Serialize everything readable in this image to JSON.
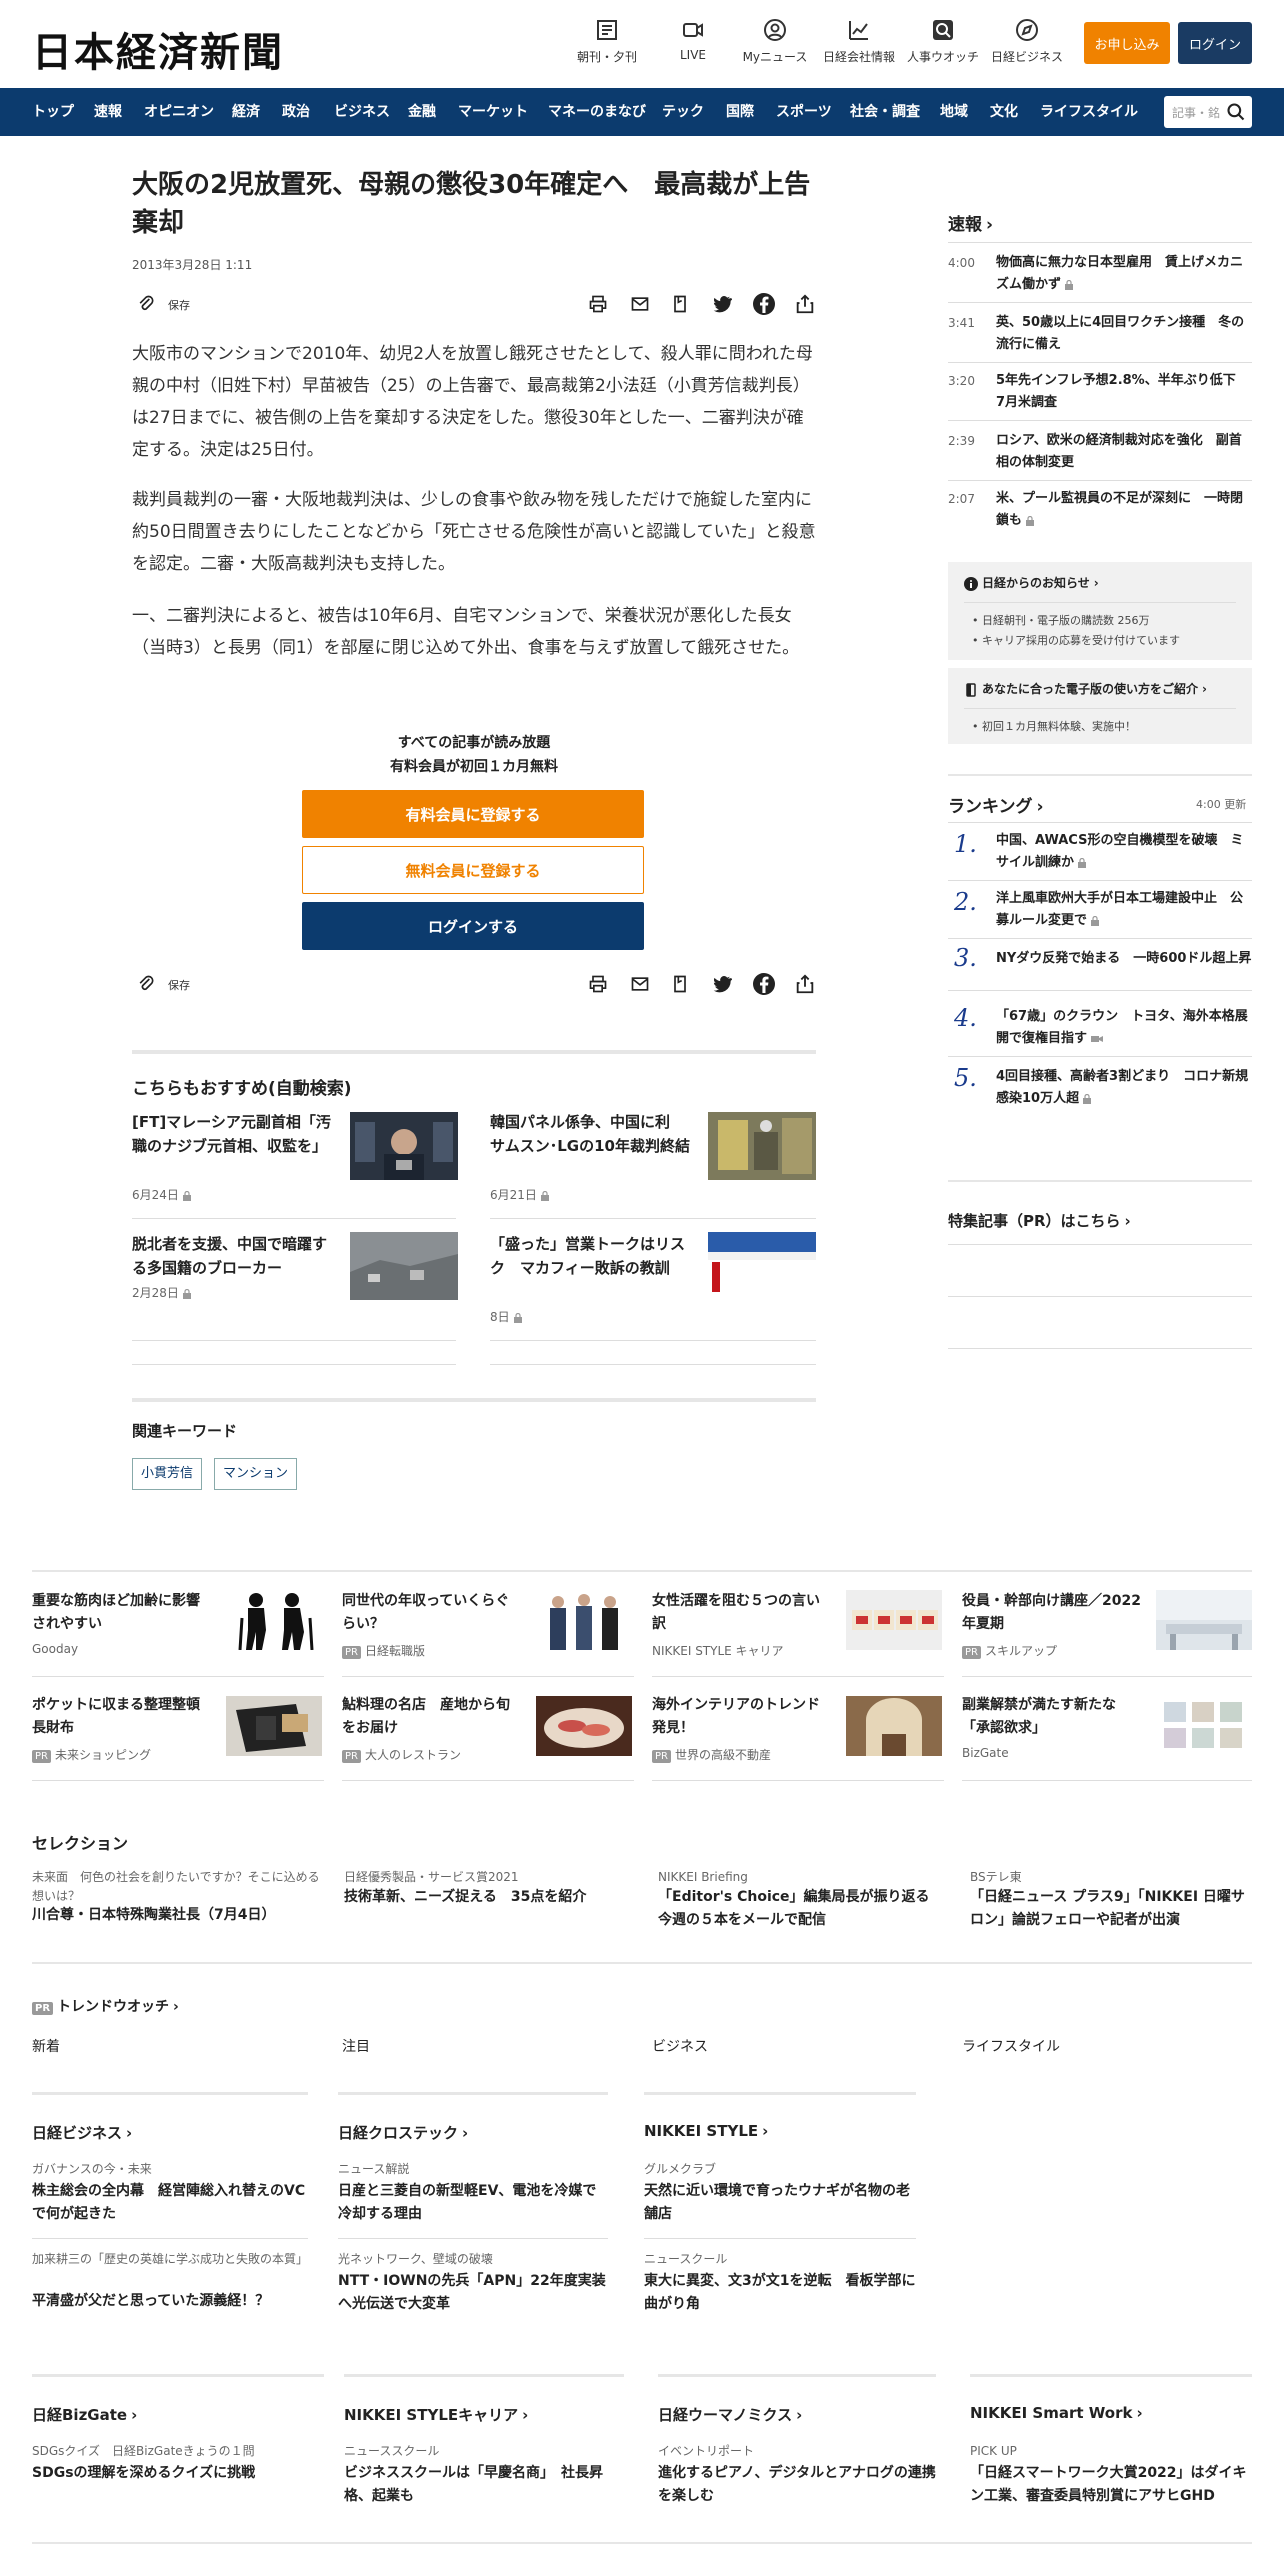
{
  "header": {
    "logo": "日本経済新聞",
    "tools": [
      {
        "label": "朝刊・夕刊",
        "icon": "newspaper-icon"
      },
      {
        "label": "LIVE",
        "icon": "video-icon"
      },
      {
        "label": "Myニュース",
        "icon": "person-icon"
      },
      {
        "label": "日経会社情報",
        "icon": "chart-icon"
      },
      {
        "label": "人事ウオッチ",
        "icon": "magnifier-icon"
      },
      {
        "label": "日経ビジネス",
        "icon": "compass-icon"
      }
    ],
    "subscribe": "お申し込み",
    "login": "ログイン"
  },
  "nav": {
    "items": [
      "トップ",
      "速報",
      "オピニオン",
      "経済",
      "政治",
      "ビジネス",
      "金融",
      "マーケット",
      "マネーのまなび",
      "テック",
      "国際",
      "スポーツ",
      "社会・調査",
      "地域",
      "文化",
      "ライフスタイル"
    ],
    "search_placeholder": "記事・銘柄"
  },
  "article": {
    "title": "大阪の2児放置死、母親の懲役30年確定へ　最高裁が上告棄却",
    "date": "2013年3月28日 1:11",
    "save": "保存",
    "paragraphs": [
      "大阪市のマンションで2010年、幼児2人を放置し餓死させたとして、殺人罪に問われた母親の中村（旧姓下村）早苗被告（25）の上告審で、最高裁第2小法廷（小貫芳信裁判長）は27日までに、被告側の上告を棄却する決定をした。懲役30年とした一、二審判決が確定する。決定は25日付。",
      "裁判員裁判の一審・大阪地裁判決は、少しの食事や飲み物を残しただけで施錠した室内に約50日間置き去りにしたことなどから「死亡させる危険性が高いと認識していた」と殺意を認定。二審・大阪高裁判決も支持した。",
      "一、二審判決によると、被告は10年6月、自宅マンションで、栄養状況が悪化した長女（当時3）と長男（同1）を部屋に閉じ込めて外出、食事を与えず放置して餓死させた。"
    ],
    "cta_line1": "すべての記事が読み放題",
    "cta_line2": "有料会員が初回１カ月無料",
    "cta_paid": "有料会員に登録する",
    "cta_free": "無料会員に登録する",
    "cta_login": "ログインする"
  },
  "recommend": {
    "heading": "こちらもおすすめ(自動検索)",
    "items": [
      {
        "title": "[FT]マレーシア元副首相「汚職のナジブ元首相、収監を」",
        "date": "6月24日"
      },
      {
        "title": "韓国パネル係争、中国に利 サムスン･LGの10年裁判終結",
        "date": "6月21日"
      },
      {
        "title": "脱北者を支援、中国で暗躍する多国籍のブローカー",
        "date": "2月28日"
      },
      {
        "title": "「盛った」営業トークはリスク　マカフィー敗訴の教訓",
        "date": "8日"
      }
    ]
  },
  "keywords": {
    "heading": "関連キーワード",
    "items": [
      "小貫芳信",
      "マンション"
    ]
  },
  "sidebar": {
    "breaking_heading": "速報",
    "breaking": [
      {
        "time": "4:00",
        "title": "物価高に無力な日本型雇用　賃上げメカニズム働かず"
      },
      {
        "time": "3:41",
        "title": "英、50歳以上に4回目ワクチン接種　冬の流行に備え"
      },
      {
        "time": "3:20",
        "title": "5年先インフレ予想2.8%、半年ぶり低下　7月米調査"
      },
      {
        "time": "2:39",
        "title": "ロシア、欧米の経済制裁対応を強化　副首相の体制変更"
      },
      {
        "time": "2:07",
        "title": "米、プール監視員の不足が深刻に　一時閉鎖も"
      }
    ],
    "notice1_head": "日経からのお知らせ",
    "notice1_items": [
      "日経朝刊・電子版の購読数 256万",
      "キャリア採用の応募を受け付けています"
    ],
    "notice2_head": "あなたに合った電子版の使い方をご紹介",
    "notice2_items": [
      "初回１カ月無料体験、実施中！"
    ],
    "ranking_heading": "ランキング",
    "ranking_time": "4:00",
    "ranking_update": "更新",
    "ranking": [
      {
        "num": "1.",
        "title": "中国、AWACS形の空自機模型を破壊　ミサイル訓練か"
      },
      {
        "num": "2.",
        "title": "洋上風車欧州大手が日本工場建設中止　公募ルール変更で"
      },
      {
        "num": "3.",
        "title": "NYダウ反発で始まる　一時600ドル超上昇"
      },
      {
        "num": "4.",
        "title": "「67歳」のクラウン　トヨタ、海外本格展開で復権目指す"
      },
      {
        "num": "5.",
        "title": "4回目接種、高齢者3割どまり　コロナ新規感染10万人超"
      }
    ],
    "pr_heading": "特集記事（PR）はこちら"
  },
  "ads": {
    "pr_label": "PR",
    "row1": [
      {
        "title": "重要な筋肉ほど加齢に影響されやすい",
        "source": "Gooday",
        "pr": false
      },
      {
        "title": "同世代の年収っていくらぐらい？",
        "source": "日経転職版",
        "pr": true
      },
      {
        "title": "女性活躍を阻む５つの言い訳",
        "source": "NIKKEI STYLE キャリア",
        "pr": false
      },
      {
        "title": "役員・幹部向け講座／2022年夏期",
        "source": "スキルアップ",
        "pr": true
      }
    ],
    "row2": [
      {
        "title": "ポケットに収まる整理整頓長財布",
        "source": "未来ショッピング",
        "pr": true
      },
      {
        "title": "鮎料理の名店　産地から旬をお届け",
        "source": "大人のレストラン",
        "pr": true
      },
      {
        "title": "海外インテリアのトレンド発見！",
        "source": "世界の高級不動産",
        "pr": true
      },
      {
        "title": "副業解禁が満たす新たな「承認欲求」",
        "source": "BizGate",
        "pr": false
      }
    ]
  },
  "selection": {
    "heading": "セレクション",
    "items": [
      {
        "kicker": "未来面　何色の社会を創りたいですか？そこに込める想いは？",
        "title": "川合尊・日本特殊陶業社長（7月4日）"
      },
      {
        "kicker": "日経優秀製品・サービス賞2021",
        "title": "技術革新、ニーズ捉える　35点を紹介"
      },
      {
        "kicker": "NIKKEI Briefing",
        "title": "「Editor's Choice」編集局長が振り返る今週の５本をメールで配信"
      },
      {
        "kicker": "BSテレ東",
        "title": "「日経ニュース プラス9」「NIKKEI 日曜サロン」論説フェローや記者が出演"
      }
    ]
  },
  "trend": {
    "heading": "トレンドウオッチ",
    "cols": [
      "新着",
      "注目",
      "ビジネス",
      "ライフスタイル"
    ]
  },
  "brands": [
    {
      "name": "日経ビジネス",
      "items": [
        {
          "kicker": "ガバナンスの今・未来",
          "title": "株主総会の全内幕　経営陣総入れ替えのVCで何が起きた"
        },
        {
          "kicker": "加来耕三の「歴史の英雄に学ぶ成功と失敗の本質」",
          "title": "平清盛が父だと思っていた源義経！？"
        }
      ]
    },
    {
      "name": "日経クロステック",
      "items": [
        {
          "kicker": "ニュース解説",
          "title": "日産と三菱自の新型軽EV、電池を冷媒で冷却する理由"
        },
        {
          "kicker": "光ネットワーク、壁域の破壊",
          "title": "NTT・IOWNの先兵「APN」22年度実装へ光伝送で大変革"
        }
      ]
    },
    {
      "name": "NIKKEI STYLE",
      "items": [
        {
          "kicker": "グルメクラブ",
          "title": "天然に近い環境で育ったウナギが名物の老舗店"
        },
        {
          "kicker": "ニュースクール",
          "title": "東大に異変、文3が文1を逆転　看板学部に曲がり角"
        }
      ]
    }
  ],
  "bottom": [
    {
      "name": "日経BizGate",
      "kicker": "SDGsクイズ　日経BizGateきょうの１問",
      "title": "SDGsの理解を深めるクイズに挑戦"
    },
    {
      "name": "NIKKEI STYLEキャリア",
      "kicker": "ニューススクール",
      "title": "ビジネススクールは「早慶名商」　社長昇格、起業も"
    },
    {
      "name": "日経ウーマノミクス",
      "kicker": "イベントリポート",
      "title": "進化するピアノ、デジタルとアナログの連携を楽しむ"
    },
    {
      "name": "NIKKEI Smart Work",
      "kicker": "PICK UP",
      "title": "「日経スマートワーク大賞2022」はダイキン工業、審査委員特別賞にアサヒGHD"
    }
  ]
}
